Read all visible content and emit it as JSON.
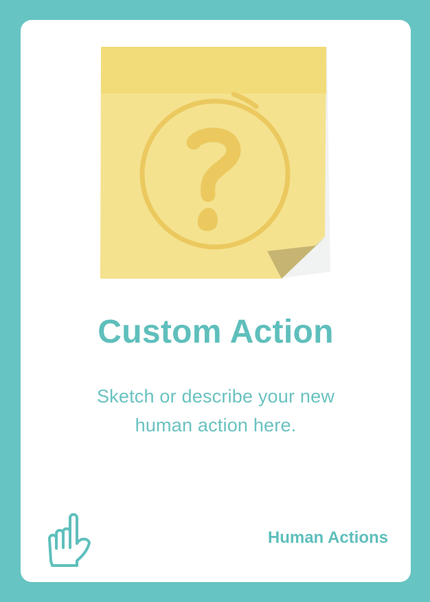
{
  "card": {
    "title": "Custom Action",
    "description_lines": [
      "Sketch or describe your new",
      "human action here."
    ],
    "category": "Human Actions",
    "illustration_icon": "question-mark-sticky-note-icon",
    "category_icon": "pointing-hand-icon"
  },
  "colors": {
    "background": "#66c4c3",
    "card": "#ffffff",
    "accent": "#5fbfbc",
    "note_yellow": "#f4e28f",
    "note_strip": "#f2db79",
    "note_mark": "#ebc95f"
  }
}
